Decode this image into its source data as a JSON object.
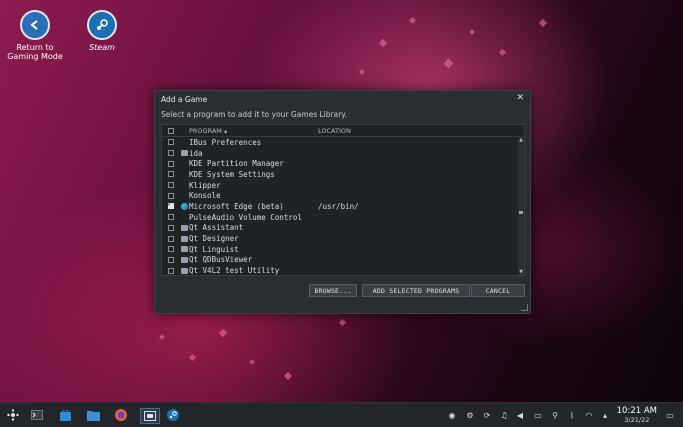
{
  "desktop": {
    "icons": [
      {
        "label_line1": "Return to",
        "label_line2": "Gaming Mode",
        "icon": "return-arrow-icon"
      },
      {
        "label": "Steam",
        "icon": "steam-icon"
      }
    ]
  },
  "dialog": {
    "title": "Add a Game",
    "close_glyph": "✕",
    "subtitle": "Select a program to add it to your Games Library.",
    "columns": {
      "program": "PROGRAM ▴",
      "location": "LOCATION"
    },
    "rows": [
      {
        "name": "IBus Preferences",
        "location": "",
        "checked": false,
        "icon": ""
      },
      {
        "name": "ida",
        "location": "",
        "checked": false,
        "icon": "app-icon"
      },
      {
        "name": "KDE Partition Manager",
        "location": "",
        "checked": false,
        "icon": ""
      },
      {
        "name": "KDE System Settings",
        "location": "",
        "checked": false,
        "icon": ""
      },
      {
        "name": "Klipper",
        "location": "",
        "checked": false,
        "icon": ""
      },
      {
        "name": "Konsole",
        "location": "",
        "checked": false,
        "icon": ""
      },
      {
        "name": "Microsoft Edge (beta)",
        "location": "/usr/bin/",
        "checked": true,
        "icon": "edge-icon"
      },
      {
        "name": "PulseAudio Volume Control",
        "location": "",
        "checked": false,
        "icon": ""
      },
      {
        "name": "Qt Assistant",
        "location": "",
        "checked": false,
        "icon": "qt-icon"
      },
      {
        "name": "Qt Designer",
        "location": "",
        "checked": false,
        "icon": "qt-icon"
      },
      {
        "name": "Qt Linguist",
        "location": "",
        "checked": false,
        "icon": "qt-icon"
      },
      {
        "name": "Qt QDBusViewer",
        "location": "",
        "checked": false,
        "icon": "qt-icon"
      },
      {
        "name": "Qt V4L2 test Utility",
        "location": "",
        "checked": false,
        "icon": "qt-icon"
      }
    ],
    "buttons": {
      "browse": "BROWSE...",
      "add": "ADD SELECTED PROGRAMS",
      "cancel": "CANCEL"
    }
  },
  "taskbar": {
    "apps": [
      "app-launcher-icon",
      "terminal-icon",
      "store-icon",
      "file-manager-icon",
      "firefox-icon",
      "screenshot-icon",
      "steam-icon"
    ],
    "tray": [
      "steam-tray-icon",
      "settings-icon",
      "update-icon",
      "audio-icon",
      "volume-icon",
      "battery-icon",
      "usb-icon",
      "bluetooth-icon",
      "wifi-icon",
      "chevron-up-icon"
    ],
    "time": "10:21 AM",
    "date": "3/21/22"
  }
}
